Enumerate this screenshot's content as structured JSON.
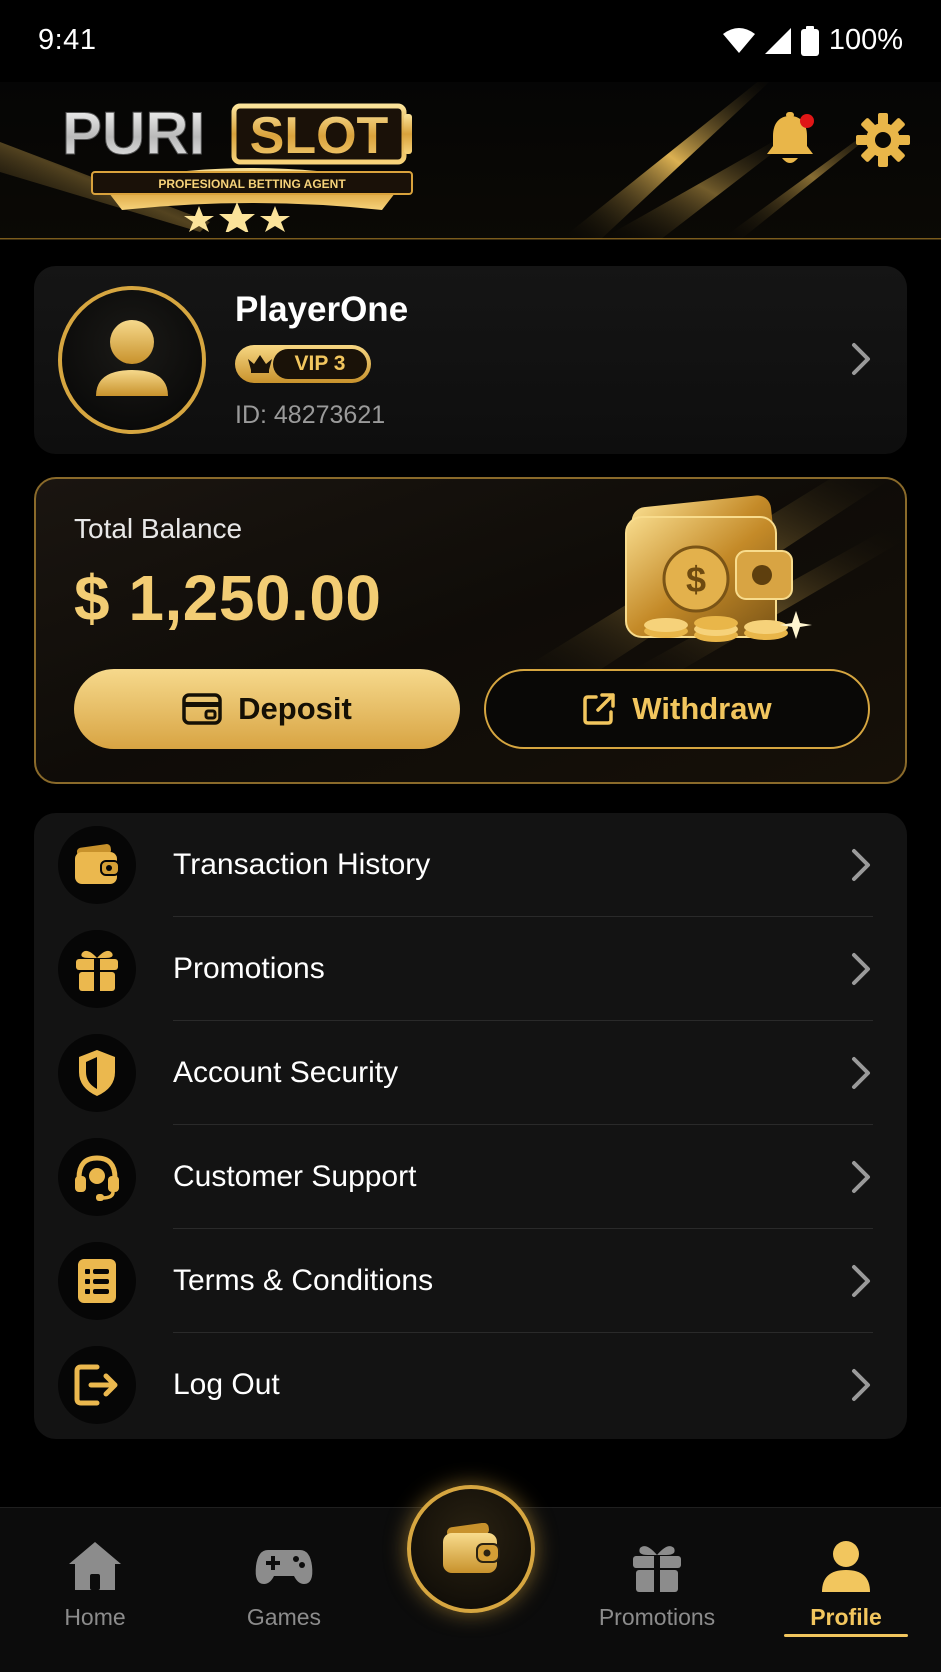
{
  "status_bar": {
    "time": "9:41",
    "battery": "100%"
  },
  "header": {
    "logo": {
      "part1": "PURI",
      "part2": "SLOT",
      "tagline": "PROFESIONAL BETTING AGENT"
    },
    "icons": [
      "bell-icon",
      "gear-icon"
    ],
    "has_notification": true
  },
  "profile": {
    "name": "PlayerOne",
    "vip": "VIP 3",
    "id": "ID: 48273621"
  },
  "balance": {
    "label": "Total Balance",
    "amount": "$ 1,250.00",
    "deposit_label": "Deposit",
    "withdraw_label": "Withdraw"
  },
  "menu": [
    {
      "label": "Transaction History",
      "icon": "wallet-icon"
    },
    {
      "label": "Promotions",
      "icon": "gift-icon"
    },
    {
      "label": "Account Security",
      "icon": "shield-icon"
    },
    {
      "label": "Customer Support",
      "icon": "headset-icon"
    },
    {
      "label": "Terms & Conditions",
      "icon": "document-icon"
    },
    {
      "label": "Log Out",
      "icon": "logout-icon"
    }
  ],
  "bottom_nav": {
    "items": [
      {
        "label": "Home",
        "icon": "home-icon"
      },
      {
        "label": "Games",
        "icon": "gamepad-icon"
      },
      {
        "label": "",
        "icon": "wallet-icon"
      },
      {
        "label": "Promotions",
        "icon": "gift-icon"
      },
      {
        "label": "Profile",
        "icon": "user-icon"
      }
    ],
    "active": "Profile"
  },
  "colors": {
    "gold": "#f2c65e",
    "gold_dark": "#c8922c",
    "background": "#000000",
    "card": "#131313",
    "notification": "#e01616"
  }
}
